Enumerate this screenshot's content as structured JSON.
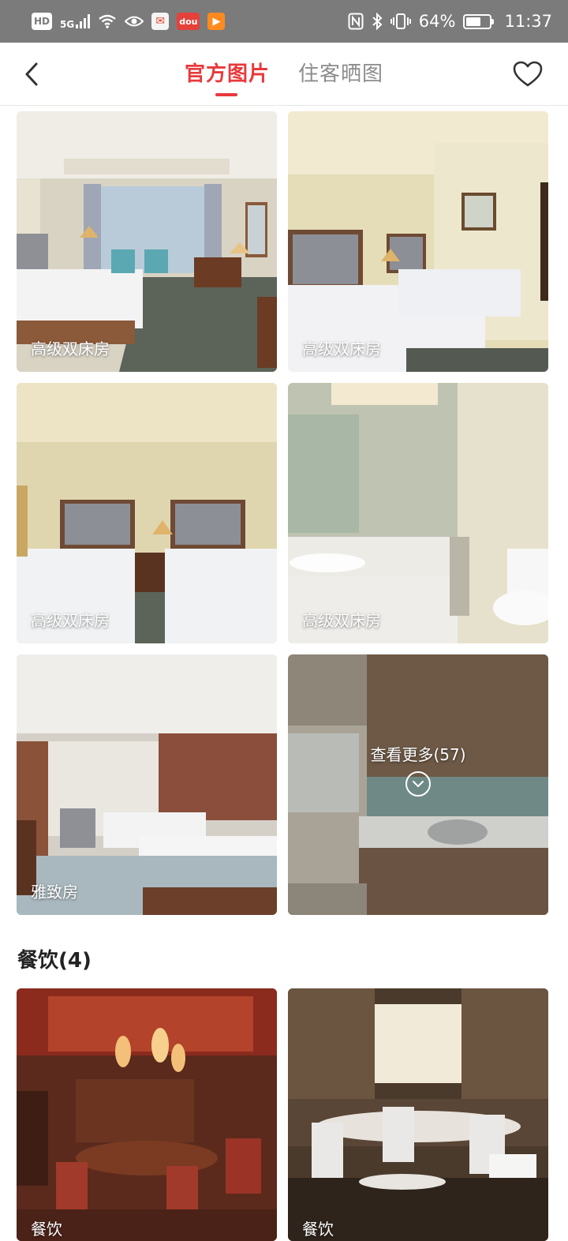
{
  "status_bar": {
    "hd": "HD",
    "network": "5G",
    "battery_percent": "64%",
    "battery_level": 0.64,
    "time": "11:37",
    "app_icons": [
      "news-app-icon",
      "dou-app-icon",
      "video-app-icon"
    ],
    "app_chip_text": [
      "✉",
      "dou",
      "▶"
    ]
  },
  "nav": {
    "tabs": [
      {
        "label": "官方图片",
        "active": true
      },
      {
        "label": "住客晒图",
        "active": false
      }
    ],
    "accent_color": "#e8393b"
  },
  "rooms": {
    "photos": [
      {
        "label": "高级双床房",
        "scene": "twin-room-window"
      },
      {
        "label": "高级双床房",
        "scene": "twin-room-painting"
      },
      {
        "label": "高级双床房",
        "scene": "twin-room-front"
      },
      {
        "label": "高级双床房",
        "scene": "bathroom"
      },
      {
        "label": "雅致房",
        "scene": "elegant-room"
      }
    ],
    "more_label": "查看更多(57)"
  },
  "dining": {
    "title": "餐饮(4)",
    "photos": [
      {
        "label": "餐饮",
        "scene": "chinese-dining-room"
      },
      {
        "label": "餐饮",
        "scene": "banquet-hall"
      }
    ]
  }
}
